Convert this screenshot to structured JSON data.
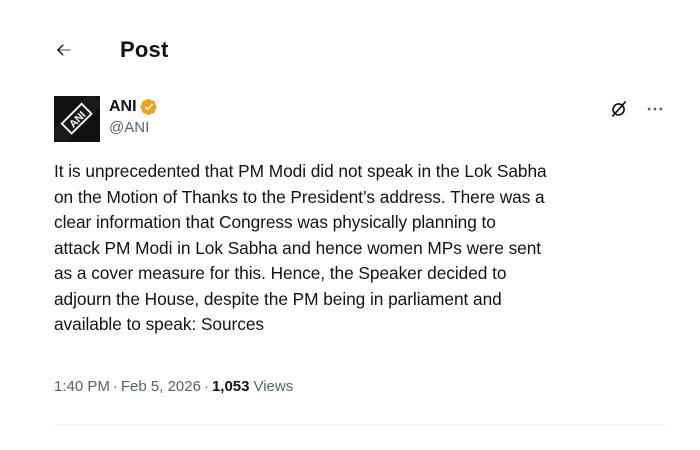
{
  "header": {
    "title": "Post",
    "back_icon": "arrow-left-icon"
  },
  "author": {
    "display_name": "ANI",
    "handle": "@ANI",
    "avatar_text": "ANI",
    "verified_icon": "verified-badge-icon",
    "verified_color": "#e8a41c"
  },
  "actions": {
    "grok_icon": "grok-icon",
    "more_icon": "more-icon",
    "more_glyph": "···"
  },
  "post": {
    "text": "It is unprecedented that PM Modi did not speak in the Lok Sabha\non the Motion of Thanks to the President’s address. There was a\nclear information that Congress was physically planning to\nattack PM Modi in Lok Sabha and hence women MPs were sent\nas a cover measure for this. Hence, the Speaker decided to\nadjourn the House, despite the PM being in parliament and\navailable to speak: Sources"
  },
  "meta": {
    "time": "1:40 PM",
    "separator": "·",
    "date": "Feb 5, 2026",
    "views_count": "1,053",
    "views_label": "Views"
  },
  "colors": {
    "text_primary": "#0f1419",
    "text_secondary": "#536471",
    "divider": "#eff3f4"
  }
}
